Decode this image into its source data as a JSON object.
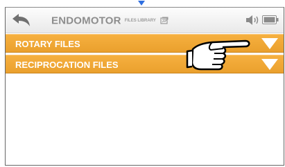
{
  "header": {
    "title": "ENDOMOTOR",
    "subtitle": "FILES LIBRARY",
    "back_icon": "back-arrow-icon",
    "library_icon": "library-icon",
    "speaker_icon": "speaker-icon",
    "battery_icon": "battery-icon"
  },
  "file_types": [
    {
      "label": "ROTARY FILES",
      "icon": "expand-triangle-icon"
    },
    {
      "label": "RECIPROCATION FILES",
      "icon": "expand-triangle-icon"
    }
  ],
  "colors": {
    "accent": "#f0a935",
    "header_text": "#8d8d8d",
    "row_text": "#ffffff",
    "pointer": "#2f6fe0"
  },
  "cursor_icon": "pointing-hand-icon"
}
